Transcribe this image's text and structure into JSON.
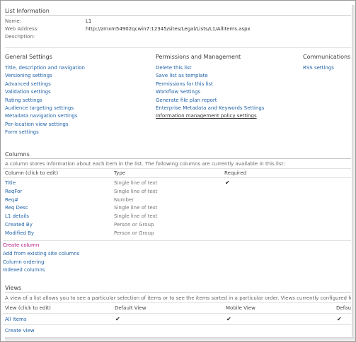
{
  "list_info": {
    "title": "List Information",
    "name_label": "Name:",
    "name_value": "L1",
    "address_label": "Web Address:",
    "address_value": "http://zmxm54902qcwin7:12345/sites/Legal/Lists/L1/AllItems.aspx",
    "description_label": "Description:"
  },
  "general": {
    "title": "General Settings",
    "links": [
      "Title, description and navigation",
      "Versioning settings",
      "Advanced settings",
      "Validation settings",
      "Rating settings",
      "Audience targeting settings",
      "Metadata navigation settings",
      "Per-location view settings",
      "Form settings"
    ]
  },
  "permissions": {
    "title": "Permissions and Management",
    "links": [
      "Delete this list",
      "Save list as template",
      "Permissions for this list",
      "Workflow Settings",
      "Generate file plan report",
      "Enterprise Metadata and Keywords Settings",
      "Information management policy settings"
    ]
  },
  "communications": {
    "title": "Communications",
    "links": [
      "RSS settings"
    ]
  },
  "columns": {
    "title": "Columns",
    "description": "A column stores information about each item in the list. The following columns are currently available in this list:",
    "headers": [
      "Column (click to edit)",
      "Type",
      "Required"
    ],
    "rows": [
      {
        "name": "Title",
        "type": "Single line of text",
        "required": "✔"
      },
      {
        "name": "ReqFor",
        "type": "Single line of text",
        "required": ""
      },
      {
        "name": "Req#",
        "type": "Number",
        "required": ""
      },
      {
        "name": "Req Desc",
        "type": "Single line of text",
        "required": ""
      },
      {
        "name": "L1 details",
        "type": "Single line of text",
        "required": ""
      },
      {
        "name": "Created By",
        "type": "Person or Group",
        "required": ""
      },
      {
        "name": "Modified By",
        "type": "Person or Group",
        "required": ""
      }
    ],
    "actions": [
      "Create column",
      "Add from existing site columns",
      "Column ordering",
      "Indexed columns"
    ]
  },
  "views": {
    "title": "Views",
    "description": "A view of a list allows you to see a particular selection of items or to see the items sorted in a particular order. Views currently configured for this list:",
    "headers": [
      "View (click to edit)",
      "Default View",
      "Mobile View",
      "Default"
    ],
    "rows": [
      {
        "name": "All Items",
        "default_view": "✔",
        "mobile_view": "✔",
        "default_mobile": "✔"
      }
    ],
    "create_label": "Create view"
  }
}
